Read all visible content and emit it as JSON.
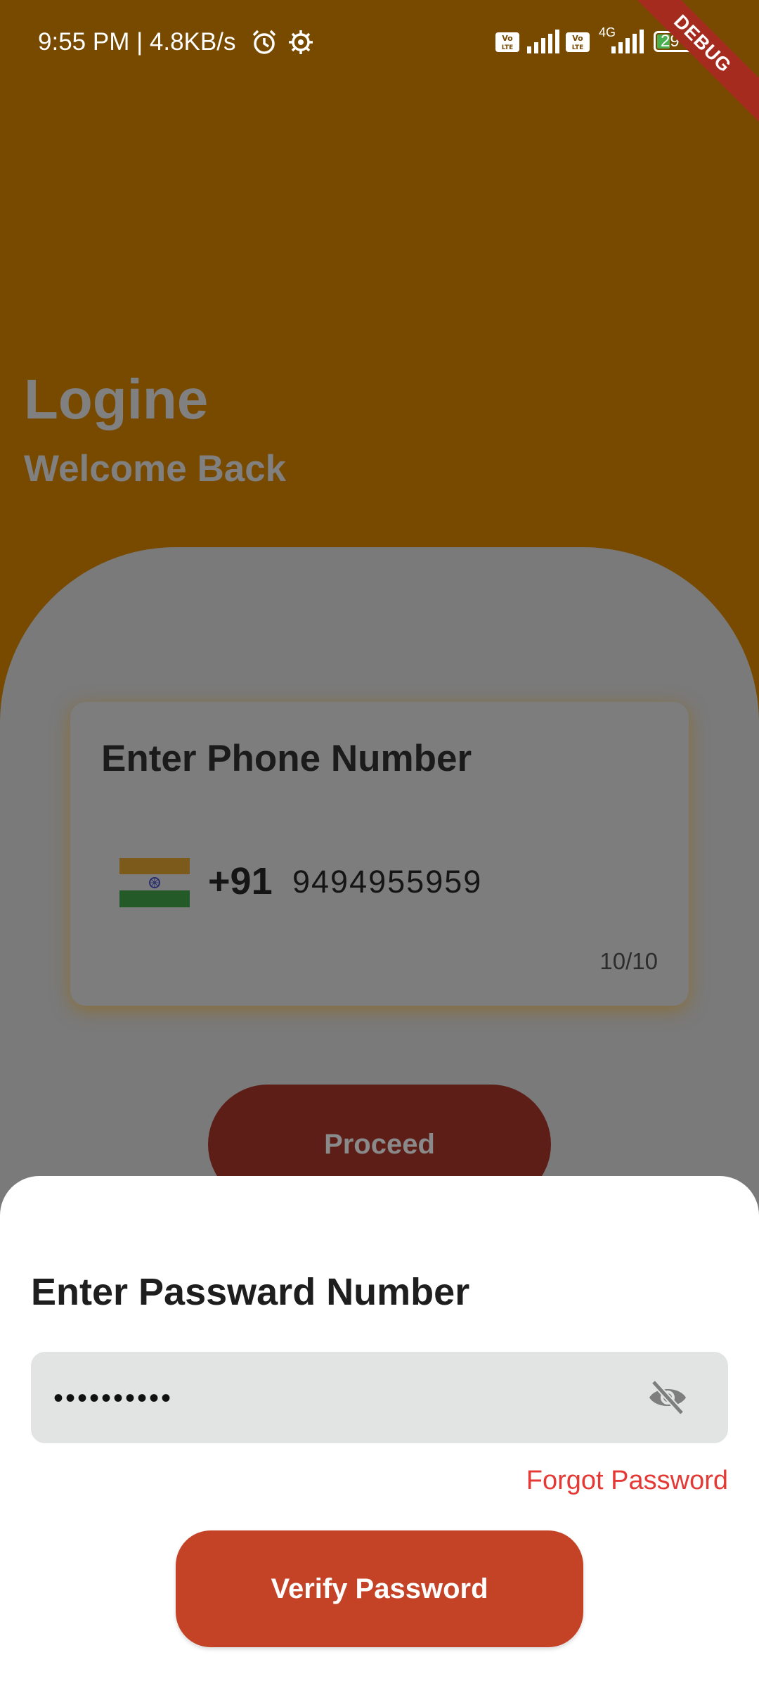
{
  "status_bar": {
    "time_speed": "9:55 PM | 4.8KB/s",
    "network": "4G",
    "battery": "29",
    "debug_label": "DEBUG"
  },
  "header": {
    "title": "Logine",
    "subtitle": "Welcome Back"
  },
  "phone_card": {
    "title": "Enter Phone Number",
    "country_code": "+91",
    "phone_number": "9494955959",
    "char_counter": "10/10",
    "flag_icon": "india-flag-icon"
  },
  "proceed_label": "Proceed",
  "password_sheet": {
    "title": "Enter Passward Number",
    "password_value": "••••••••••",
    "visibility_icon": "eye-off-icon",
    "forgot_label": "Forgot Password",
    "verify_label": "Verify Password"
  },
  "colors": {
    "header_bg": "#784a00",
    "panel_bg": "#7a7a7a",
    "accent": "#c44226",
    "link": "#e53935"
  }
}
